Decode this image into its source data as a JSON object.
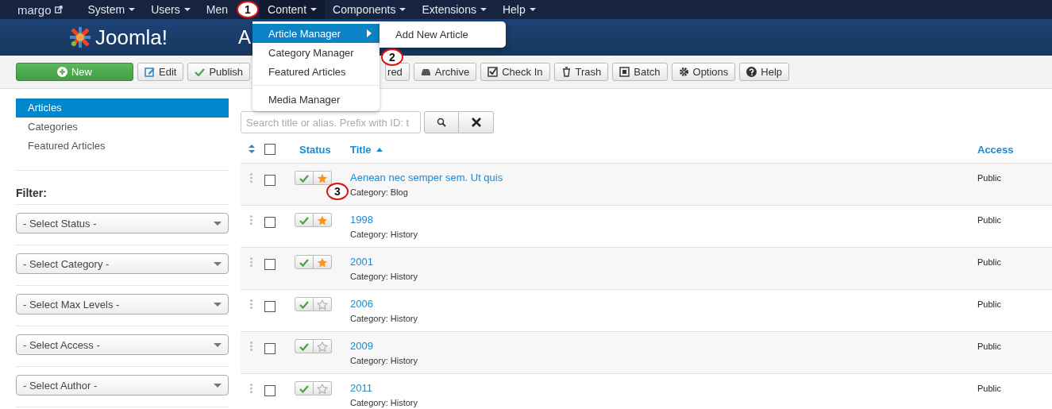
{
  "top_nav": {
    "site": "margo",
    "items": [
      {
        "label": "System",
        "caret": true,
        "open": false
      },
      {
        "label": "Users",
        "caret": true,
        "open": false
      },
      {
        "label": "Men",
        "caret": false,
        "open": false
      },
      {
        "label": "Content",
        "caret": true,
        "open": true
      },
      {
        "label": "Components",
        "caret": true,
        "open": false
      },
      {
        "label": "Extensions",
        "caret": true,
        "open": false
      },
      {
        "label": "Help",
        "caret": true,
        "open": false
      }
    ]
  },
  "header": {
    "logo": "Joomla!",
    "title": "A"
  },
  "toolbar": [
    {
      "label": "New",
      "kind": "primary"
    },
    {
      "label": "Edit",
      "kind": "default"
    },
    {
      "label": "Publish",
      "kind": "default"
    },
    {
      "label": "red",
      "kind": "partial"
    },
    {
      "label": "Archive",
      "kind": "default"
    },
    {
      "label": "Check In",
      "kind": "default"
    },
    {
      "label": "Trash",
      "kind": "default"
    },
    {
      "label": "Batch",
      "kind": "default"
    },
    {
      "label": "Options",
      "kind": "default"
    },
    {
      "label": "Help",
      "kind": "default"
    }
  ],
  "content_menu": {
    "items": [
      {
        "label": "Article Manager",
        "selected": true,
        "submenu": true,
        "divider_before": false
      },
      {
        "label": "Category Manager",
        "selected": false,
        "submenu": false,
        "divider_before": false
      },
      {
        "label": "Featured Articles",
        "selected": false,
        "submenu": false,
        "divider_before": false
      },
      {
        "label": "Media Manager",
        "selected": false,
        "submenu": false,
        "divider_before": true
      }
    ],
    "submenu": [
      "Add New Article"
    ]
  },
  "sidebar": {
    "items": [
      {
        "label": "Articles",
        "selected": true
      },
      {
        "label": "Categories",
        "selected": false
      },
      {
        "label": "Featured Articles",
        "selected": false
      }
    ],
    "filter_title": "Filter:",
    "filters": [
      "- Select Status -",
      "- Select Category -",
      "- Select Max Levels -",
      "- Select Access -",
      "- Select Author -"
    ]
  },
  "search": {
    "placeholder": "Search title or alias. Prefix with ID: t"
  },
  "table": {
    "columns": [
      "Status",
      "Title",
      "Access"
    ],
    "select_all_checked": false,
    "rows": [
      {
        "checked": false,
        "title": "Aenean nec semper sem. Ut quis",
        "category": "Category: Blog",
        "published": true,
        "featured": true,
        "access": "Public"
      },
      {
        "checked": false,
        "title": "1998",
        "category": "Category: History",
        "published": true,
        "featured": true,
        "access": "Public"
      },
      {
        "checked": false,
        "title": "2001",
        "category": "Category: History",
        "published": true,
        "featured": true,
        "access": "Public"
      },
      {
        "checked": false,
        "title": "2006",
        "category": "Category: History",
        "published": true,
        "featured": false,
        "access": "Public"
      },
      {
        "checked": false,
        "title": "2009",
        "category": "Category: History",
        "published": true,
        "featured": false,
        "access": "Public"
      },
      {
        "checked": false,
        "title": "2011",
        "category": "Category: History",
        "published": true,
        "featured": false,
        "access": "Public"
      }
    ]
  },
  "callouts": [
    "1",
    "2",
    "3"
  ]
}
